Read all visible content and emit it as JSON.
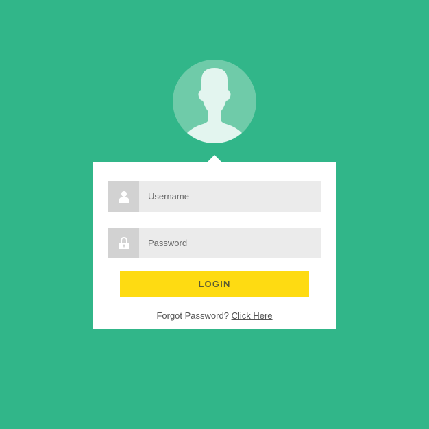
{
  "colors": {
    "background": "#31b689",
    "avatar_circle": "#6fcba9",
    "avatar_silhouette": "#e3f5ef",
    "card": "#ffffff",
    "field_background": "#ebebeb",
    "field_icon_background": "#d2d2d2",
    "login_button": "#fedb12"
  },
  "avatar": {
    "icon": "user-silhouette-icon"
  },
  "form": {
    "username": {
      "icon": "user-icon",
      "placeholder": "Username",
      "value": ""
    },
    "password": {
      "icon": "lock-icon",
      "placeholder": "Password",
      "value": ""
    },
    "login_label": "LOGIN",
    "forgot_text": "Forgot Password?",
    "forgot_link": "Click Here"
  }
}
